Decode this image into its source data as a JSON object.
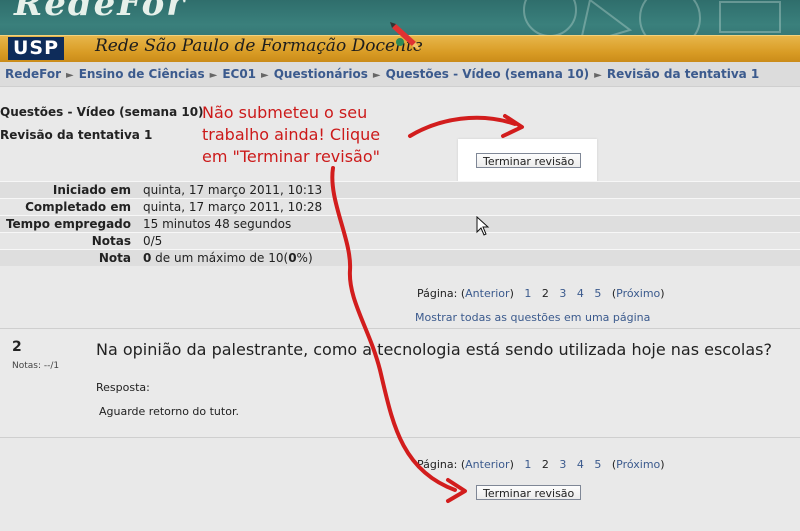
{
  "header": {
    "brand": "RedeFor",
    "network_name": "Rede São Paulo de Formação Docente",
    "usp_logo": "USP",
    "colors": {
      "teal": "#2f6e6c",
      "orange": "#d99c25",
      "link": "#3b5a8d",
      "annotation": "#cc1a1a"
    }
  },
  "breadcrumb": {
    "items": [
      "RedeFor",
      "Ensino de Ciências",
      "EC01",
      "Questionários",
      "Questões - Vídeo (semana 10)",
      "Revisão da tentativa 1"
    ],
    "separator": "►"
  },
  "page": {
    "quiz_title": "Questões - Vídeo (semana 10)",
    "attempt_title": "Revisão da tentativa 1",
    "finish_button": "Terminar revisão"
  },
  "summary": [
    {
      "label": "Iniciado em",
      "value": "quinta, 17 março 2011, 10:13"
    },
    {
      "label": "Completado em",
      "value": "quinta, 17 março 2011, 10:28"
    },
    {
      "label": "Tempo empregado",
      "value": "15 minutos 48 segundos"
    },
    {
      "label": "Notas",
      "value": "0/5"
    },
    {
      "label": "Nota",
      "value_bold_a": "0",
      "value_mid": " de um máximo de 10(",
      "value_bold_b": "0",
      "value_end": "%)"
    }
  ],
  "pager": {
    "label": "Página:",
    "prev": "Anterior",
    "pages": [
      "1",
      "2",
      "3",
      "4",
      "5"
    ],
    "current": "2",
    "next": "Próximo",
    "show_all": "Mostrar todas as questões em uma página"
  },
  "question": {
    "number": "2",
    "grade": "Notas: --/1",
    "text": "Na opinião da palestrante, como a tecnologia está sendo utilizada hoje nas escolas?",
    "answer_label": "Resposta:",
    "feedback": "Aguarde retorno do tutor."
  },
  "annotation": {
    "lines": [
      "Não submeteu o seu",
      "trabalho ainda! Clique",
      "em \"Terminar revisão\""
    ]
  }
}
